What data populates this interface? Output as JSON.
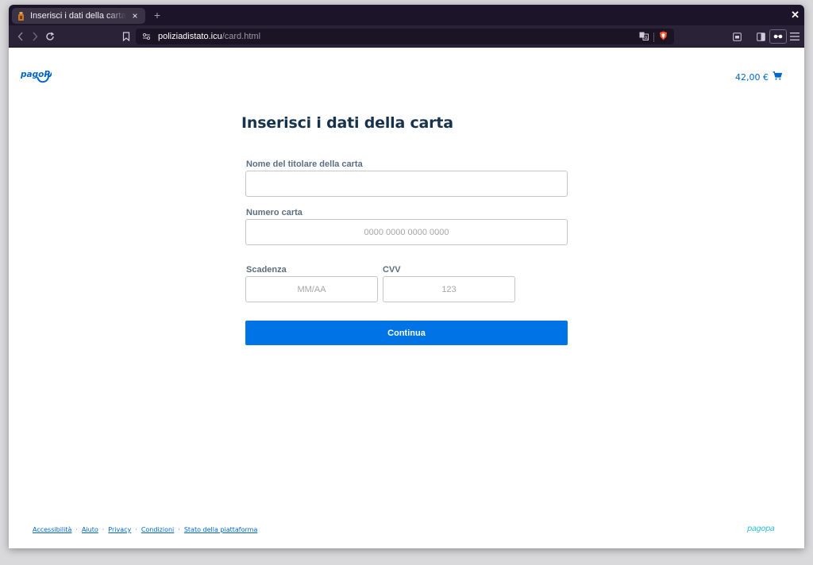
{
  "browser": {
    "tab_title": "Inserisci i dati della carta",
    "close_tab": "×",
    "new_tab": "+",
    "url_host": "poliziadistato.icu",
    "url_path": "/card.html"
  },
  "header": {
    "logo_text": "pagoPA",
    "cart_amount": "42,00 €"
  },
  "form": {
    "title": "Inserisci i dati della carta",
    "holder_label": "Nome del titolare della carta",
    "holder_value": "",
    "number_label": "Numero carta",
    "number_placeholder": "0000 0000 0000 0000",
    "expiry_label": "Scadenza",
    "expiry_placeholder": "MM/AA",
    "cvv_label": "CVV",
    "cvv_placeholder": "123",
    "submit_label": "Continua"
  },
  "footer": {
    "links": [
      "Accessibilità",
      "Aiuto",
      "Privacy",
      "Condizioni",
      "Stato della piattaforma"
    ],
    "separator": "·",
    "logo_text": "pagopa"
  },
  "colors": {
    "brand_blue": "#0073e6",
    "title_navy": "#17324d",
    "browser_dark": "#1c1428"
  }
}
